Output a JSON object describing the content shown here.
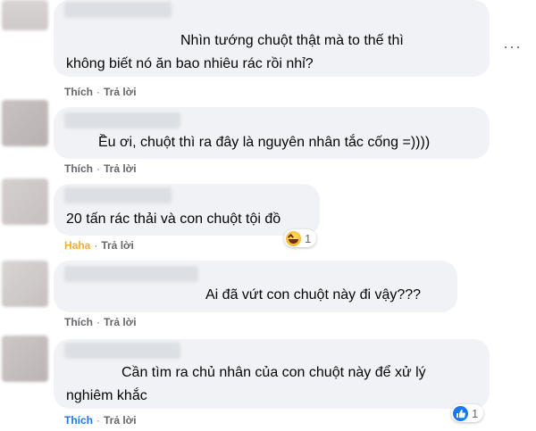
{
  "comments": [
    {
      "lines": [
        "Nhìn tướng chuột thật mà to thế thì",
        "không biết nó ăn bao nhiêu rác rồi nhỉ?"
      ],
      "actions": {
        "react": "Thích",
        "reply": "Trả lời"
      }
    },
    {
      "lines": [
        "Ều ơi, chuột thì ra đây là nguyên nhân tắc cống =))))"
      ],
      "actions": {
        "react": "Thích",
        "reply": "Trả lời"
      }
    },
    {
      "lines": [
        "20 tấn rác thải và con chuột tội đồ"
      ],
      "actions": {
        "react": "Haha",
        "reply": "Trả lời"
      },
      "reaction": {
        "icon": "haha-emoji-icon",
        "count": "1"
      }
    },
    {
      "lines": [
        "Ai đã vứt con chuột này đi vậy???"
      ],
      "actions": {
        "react": "Thích",
        "reply": "Trả lời"
      }
    },
    {
      "lines": [
        "Cần tìm ra chủ nhân của con chuột này để xử lý",
        "nghiêm khắc"
      ],
      "actions": {
        "react": "Thích",
        "reply": "Trả lời"
      },
      "reaction": {
        "icon": "like-emoji-icon",
        "count": "1"
      }
    }
  ],
  "more_options_glyph": "···",
  "colors": {
    "bubble": "#f0f2f5",
    "action_text": "#65676b",
    "haha": "#f7b125",
    "like": "#1877f2"
  }
}
